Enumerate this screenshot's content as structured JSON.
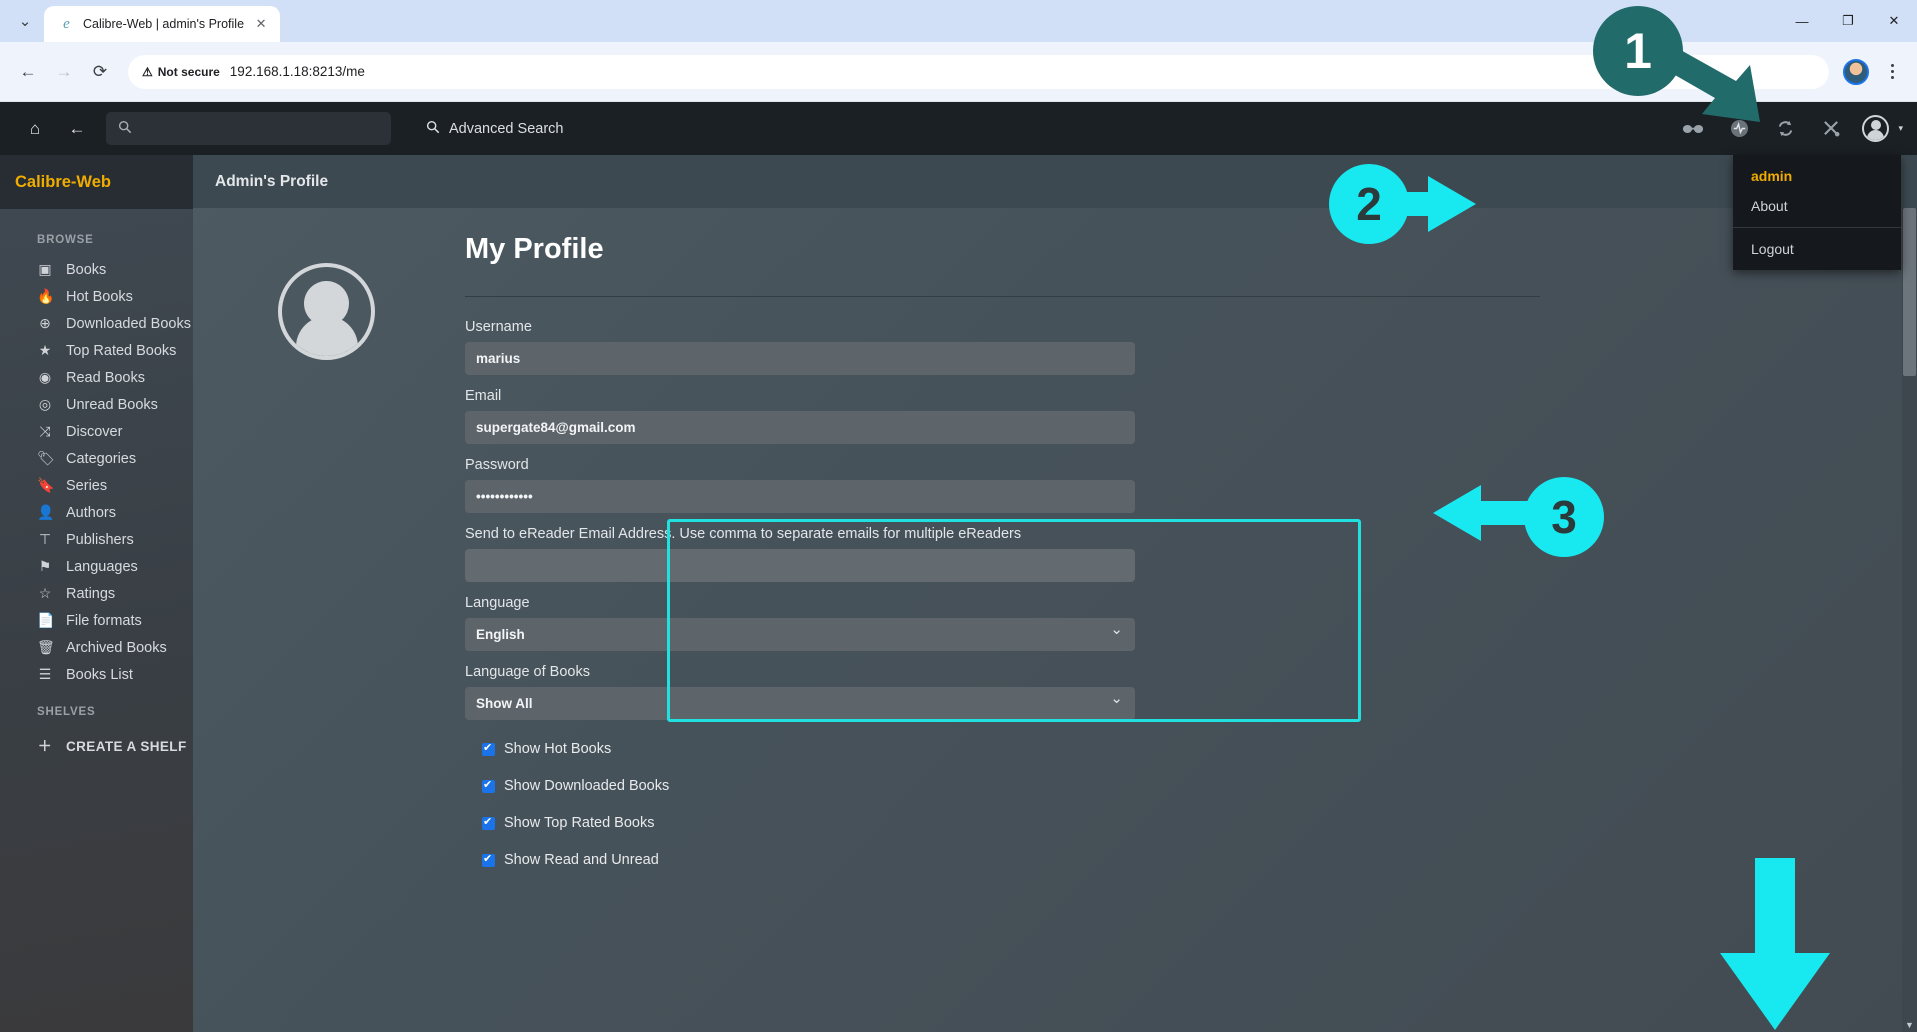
{
  "browser": {
    "tab_title": "Calibre-Web | admin's Profile",
    "tab_favicon": "e",
    "close_icon": "✕",
    "chevron_icon": "⌄",
    "back_icon": "←",
    "forward_icon": "→",
    "reload_icon": "⟳",
    "security_label": "Not secure",
    "security_icon": "⚠",
    "url": "192.168.1.18:8213/me",
    "window_minimize": "—",
    "window_maximize": "❐",
    "window_close": "✕"
  },
  "topnav": {
    "home_icon": "⌂",
    "back_icon": "←",
    "search_icon": "🔍",
    "search_placeholder": "",
    "advanced_search_label": "Advanced Search",
    "advanced_search_icon": "🔍",
    "right_icons": [
      {
        "name": "glasses-icon",
        "glyph": "👓"
      },
      {
        "name": "activity-icon",
        "glyph": "◉"
      },
      {
        "name": "sync-icon",
        "glyph": "⟳"
      },
      {
        "name": "tools-icon",
        "glyph": "✂"
      }
    ],
    "caret": "▾"
  },
  "dropdown": {
    "items": [
      {
        "label": "admin",
        "active": true
      },
      {
        "label": "About",
        "active": false
      },
      {
        "label": "Logout",
        "active": false
      }
    ]
  },
  "sidebar": {
    "brand": "Calibre-Web",
    "browse_label": "BROWSE",
    "items": [
      {
        "label": "Books",
        "icon": "▣"
      },
      {
        "label": "Hot Books",
        "icon": "🔥"
      },
      {
        "label": "Downloaded Books",
        "icon": "⊕"
      },
      {
        "label": "Top Rated Books",
        "icon": "★"
      },
      {
        "label": "Read Books",
        "icon": "◉"
      },
      {
        "label": "Unread Books",
        "icon": "◎"
      },
      {
        "label": "Discover",
        "icon": "⤨"
      },
      {
        "label": "Categories",
        "icon": "🏷"
      },
      {
        "label": "Series",
        "icon": "🔖"
      },
      {
        "label": "Authors",
        "icon": "👤"
      },
      {
        "label": "Publishers",
        "icon": "⊤"
      },
      {
        "label": "Languages",
        "icon": "⚑"
      },
      {
        "label": "Ratings",
        "icon": "☆"
      },
      {
        "label": "File formats",
        "icon": "📄"
      },
      {
        "label": "Archived Books",
        "icon": "🗑"
      },
      {
        "label": "Books List",
        "icon": "☰"
      }
    ],
    "shelves_label": "SHELVES",
    "create_shelf_label": "CREATE A SHELF",
    "create_shelf_icon": "＋"
  },
  "content": {
    "header": "Admin's Profile",
    "page_title": "My Profile",
    "fields": [
      {
        "label": "Username",
        "value": "marius",
        "name": "username"
      },
      {
        "label": "Email",
        "value": "supergate84@gmail.com",
        "name": "email"
      },
      {
        "label": "Password",
        "value": "••••••••••••",
        "name": "password"
      },
      {
        "label": "Send to eReader Email Address. Use comma to separate emails for multiple eReaders",
        "value": "",
        "name": "ereader-email"
      }
    ],
    "selects": [
      {
        "label": "Language",
        "value": "English",
        "name": "language"
      },
      {
        "label": "Language of Books",
        "value": "Show All",
        "name": "language-of-books"
      }
    ],
    "checkboxes": [
      {
        "label": "Show Hot Books",
        "checked": true
      },
      {
        "label": "Show Downloaded Books",
        "checked": true
      },
      {
        "label": "Show Top Rated Books",
        "checked": true
      },
      {
        "label": "Show Read and Unread",
        "checked": true
      }
    ]
  },
  "annotations": {
    "badge1": "1",
    "badge2": "2",
    "badge3": "3",
    "color_dark_teal": "#226b6b",
    "color_cyan": "#18e8f0"
  }
}
